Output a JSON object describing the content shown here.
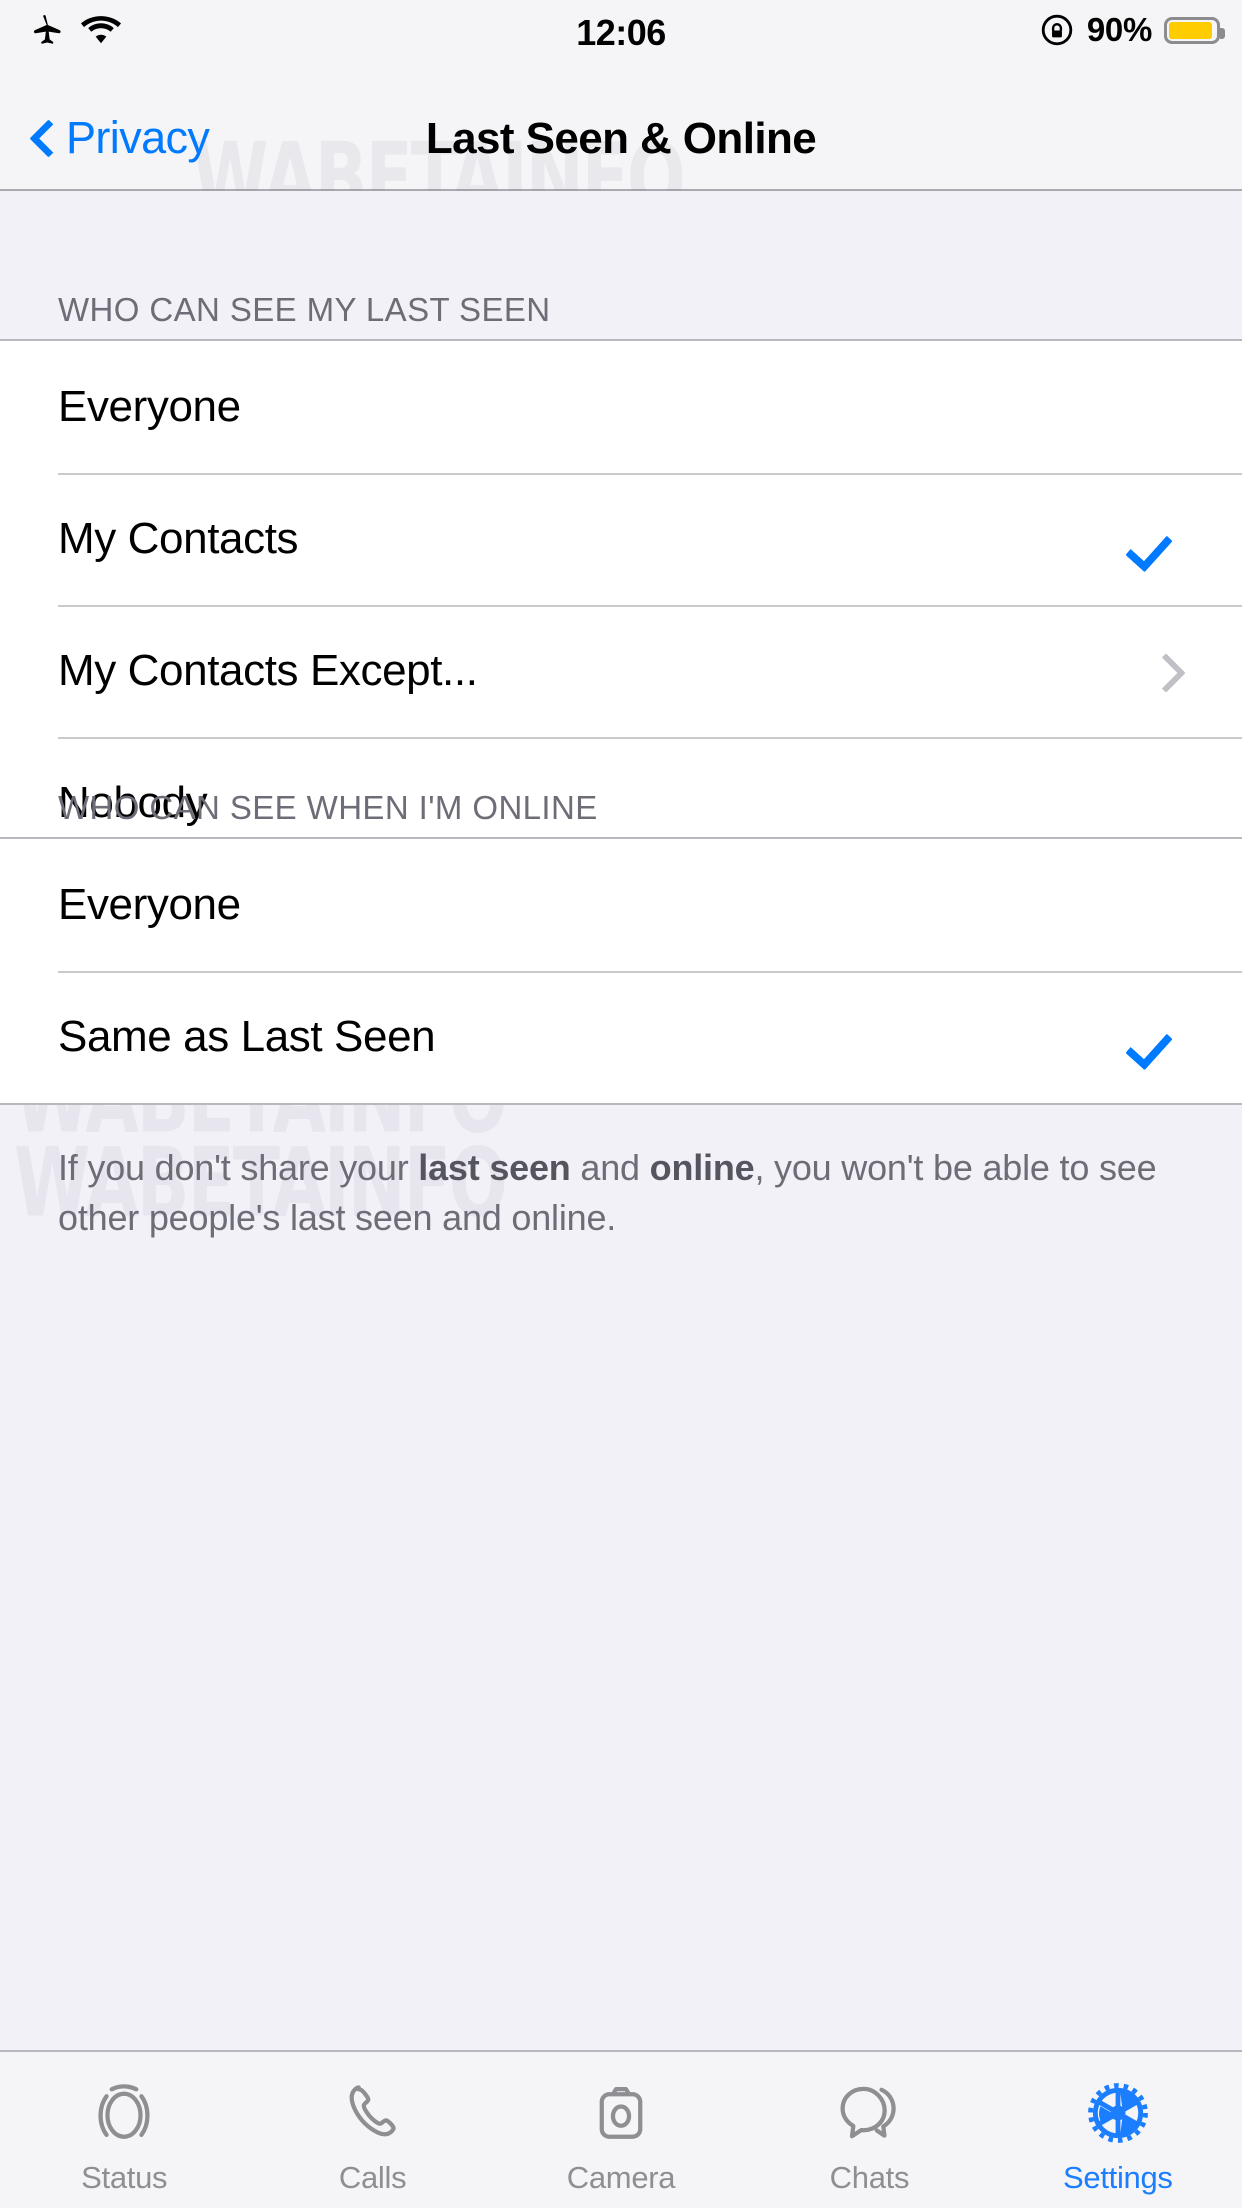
{
  "status_bar": {
    "airplane_icon": "airplane-mode-icon",
    "wifi_icon": "wifi-icon",
    "time": "12:06",
    "rotation_lock_icon": "rotation-lock-icon",
    "battery_percent": "90%",
    "battery_level": 90,
    "battery_color": "#ffcc00"
  },
  "nav": {
    "back_label": "Privacy",
    "title": "Last Seen & Online",
    "accent_color": "#007aff"
  },
  "watermark": {
    "text": "WABETAINFO"
  },
  "sections": [
    {
      "header": "WHO CAN SEE MY LAST SEEN",
      "rows": [
        {
          "label": "Everyone",
          "accessory": "none"
        },
        {
          "label": "My Contacts",
          "accessory": "check"
        },
        {
          "label": "My Contacts Except...",
          "accessory": "chevron"
        },
        {
          "label": "Nobody",
          "accessory": "none"
        }
      ]
    },
    {
      "header": "WHO CAN SEE WHEN I'M ONLINE",
      "rows": [
        {
          "label": "Everyone",
          "accessory": "none"
        },
        {
          "label": "Same as Last Seen",
          "accessory": "check"
        }
      ]
    }
  ],
  "footnote": {
    "part1": "If you don't share your ",
    "bold1": "last seen",
    "part2": " and ",
    "bold2": "online",
    "part3": ", you won't be able to see other people's last seen and online."
  },
  "tabbar": {
    "items": [
      {
        "label": "Status",
        "icon": "status-rings-icon",
        "active": false
      },
      {
        "label": "Calls",
        "icon": "phone-icon",
        "active": false
      },
      {
        "label": "Camera",
        "icon": "camera-icon",
        "active": false
      },
      {
        "label": "Chats",
        "icon": "chat-bubbles-icon",
        "active": false
      },
      {
        "label": "Settings",
        "icon": "gear-icon",
        "active": true
      }
    ],
    "active_color": "#1b7eff",
    "inactive_color": "#8e8e93"
  }
}
